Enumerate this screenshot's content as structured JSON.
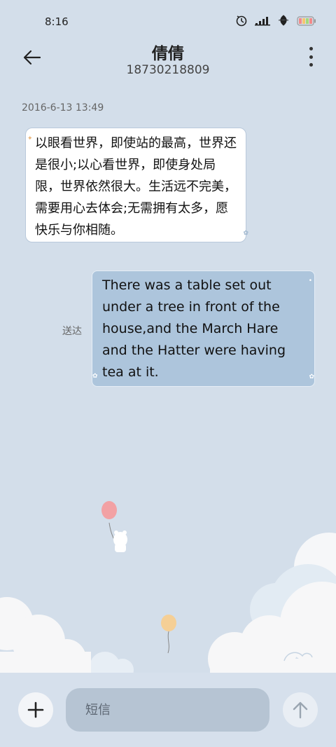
{
  "status_bar": {
    "time": "8:16",
    "icons": [
      "timer-icon",
      "signal-icon",
      "leaf-icon",
      "battery-icon"
    ]
  },
  "header": {
    "back_icon": "back-arrow-icon",
    "title": "倩倩",
    "subtitle": "18730218809",
    "more_icon": "more-vertical-icon"
  },
  "conversation": {
    "timestamp": "2016-6-13 13:49",
    "messages": [
      {
        "direction": "incoming",
        "text": "以眼看世界，即使站的最高，世界还是很小;以心看世界，即使身处局限，世界依然很大。生活远不完美，需要用心去体会;无需拥有太多，愿快乐与你相随。"
      },
      {
        "direction": "outgoing",
        "text": "There was a table set out under a tree in front of the house,and the March Hare and the Hatter were having tea at it.",
        "status": "送达"
      }
    ]
  },
  "input_bar": {
    "add_icon": "plus-icon",
    "placeholder": "短信",
    "send_icon": "send-arrow-icon"
  },
  "colors": {
    "background": "#d3deea",
    "incoming_bubble": "#ffffff",
    "outgoing_bubble": "#adc5dc",
    "input_bg": "#b6c4d3"
  }
}
